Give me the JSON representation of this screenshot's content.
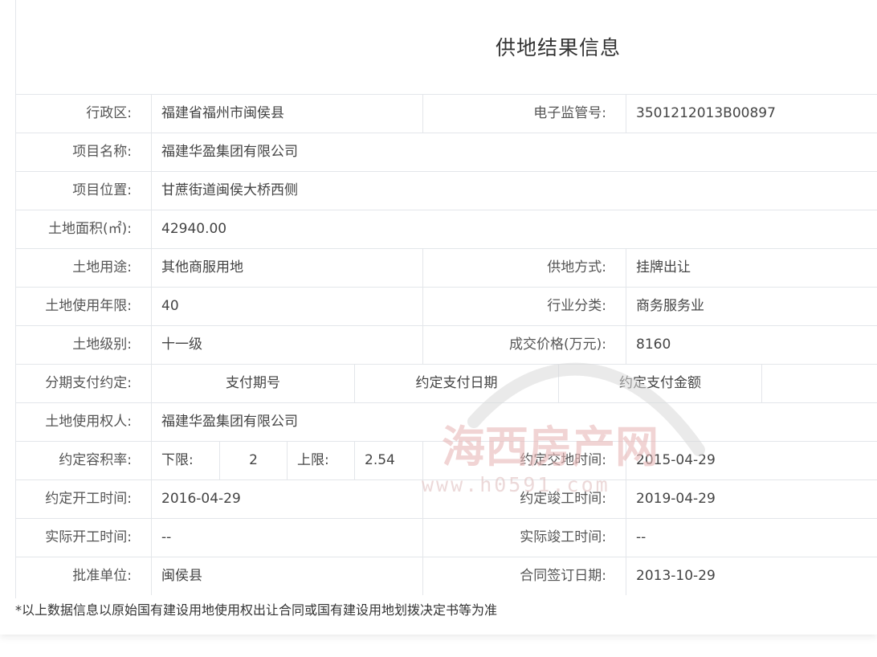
{
  "title": "供地结果信息",
  "rows": {
    "admin_region": {
      "label": "行政区:",
      "value": "福建省福州市闽侯县"
    },
    "supervision_no": {
      "label": "电子监管号:",
      "value": "3501212013B00897"
    },
    "project_name": {
      "label": "项目名称:",
      "value": "福建华盈集团有限公司"
    },
    "project_location": {
      "label": "项目位置:",
      "value": "甘蔗街道闽侯大桥西侧"
    },
    "land_area": {
      "label": "土地面积(㎡):",
      "value": "42940.00"
    },
    "land_use": {
      "label": "土地用途:",
      "value": "其他商服用地"
    },
    "supply_method": {
      "label": "供地方式:",
      "value": "挂牌出让"
    },
    "use_years": {
      "label": "土地使用年限:",
      "value": "40"
    },
    "industry": {
      "label": "行业分类:",
      "value": "商务服务业"
    },
    "land_grade": {
      "label": "土地级别:",
      "value": "十一级"
    },
    "deal_price": {
      "label": "成交价格(万元):",
      "value": "8160"
    },
    "installment": {
      "label": "分期支付约定:",
      "col_period": "支付期号",
      "col_date": "约定支付日期",
      "col_amount": "约定支付金额"
    },
    "land_user": {
      "label": "土地使用权人:",
      "value": "福建华盈集团有限公司"
    },
    "far": {
      "label": "约定容积率:",
      "lower_label": "下限:",
      "lower_value": "2",
      "upper_label": "上限:",
      "upper_value": "2.54"
    },
    "delivery_time": {
      "label": "约定交地时间:",
      "value": "2015-04-29"
    },
    "planned_start": {
      "label": "约定开工时间:",
      "value": "2016-04-29"
    },
    "planned_finish": {
      "label": "约定竣工时间:",
      "value": "2019-04-29"
    },
    "actual_start": {
      "label": "实际开工时间:",
      "value": "--"
    },
    "actual_finish": {
      "label": "实际竣工时间:",
      "value": "--"
    },
    "approval_unit": {
      "label": "批准单位:",
      "value": "闽侯县"
    },
    "contract_date": {
      "label": "合同签订日期:",
      "value": "2013-10-29"
    }
  },
  "footnote": "*以上数据信息以原始国有建设用地使用权出让合同或国有建设用地划拨决定书等为准",
  "watermark": {
    "brand": "海西房产网",
    "url": "www.h0591.com"
  },
  "colors": {
    "border": "#e3e6ea",
    "text": "#444444",
    "watermark": "#e8b8b8"
  }
}
